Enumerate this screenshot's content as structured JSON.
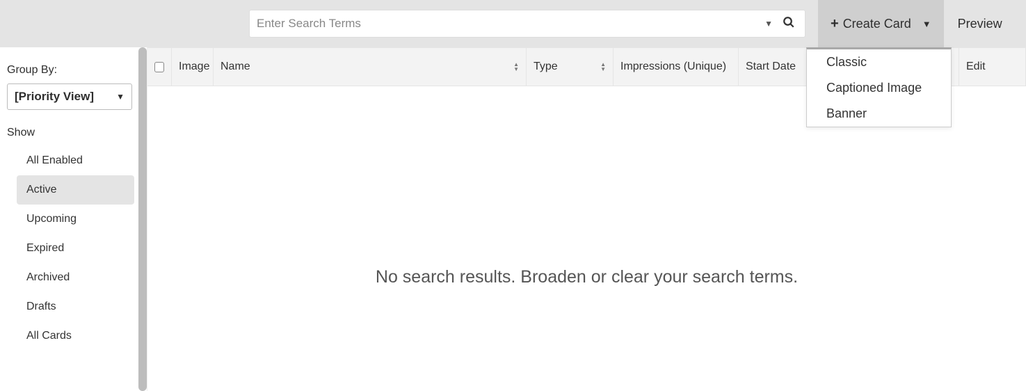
{
  "topbar": {
    "search_placeholder": "Enter Search Terms",
    "create_label": "Create Card",
    "preview_label": "Preview"
  },
  "create_menu": {
    "items": [
      "Classic",
      "Captioned Image",
      "Banner"
    ]
  },
  "sidebar": {
    "group_by_label": "Group By:",
    "group_by_value": "[Priority View]",
    "show_label": "Show",
    "filters": [
      "All Enabled",
      "Active",
      "Upcoming",
      "Expired",
      "Archived",
      "Drafts",
      "All Cards"
    ],
    "active_filter": "Active"
  },
  "table": {
    "columns": {
      "image": "Image",
      "name": "Name",
      "type": "Type",
      "impressions": "Impressions (Unique)",
      "start_date": "Start Date",
      "edit": "Edit"
    },
    "empty_message": "No search results. Broaden or clear your search terms."
  }
}
